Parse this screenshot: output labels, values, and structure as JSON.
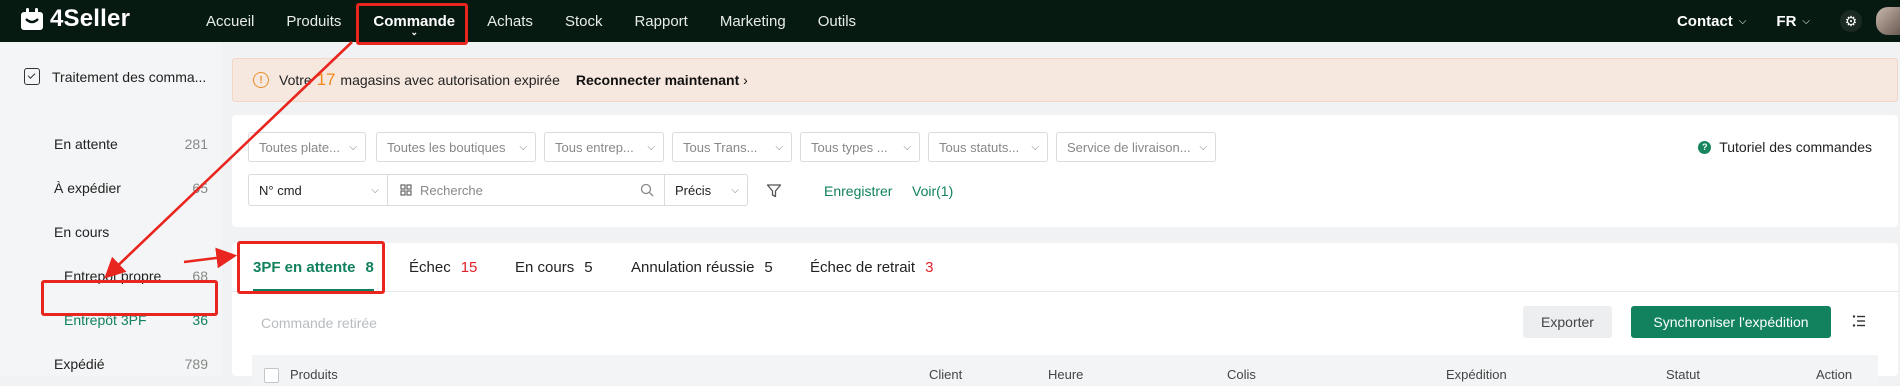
{
  "app": {
    "name": "4Seller"
  },
  "nav": {
    "items": [
      "Accueil",
      "Produits",
      "Commande",
      "Achats",
      "Stock",
      "Rapport",
      "Marketing",
      "Outils"
    ],
    "active": "Commande",
    "contact": "Contact",
    "language": "FR"
  },
  "sidebar": {
    "header": "Traitement des comma...",
    "items": [
      {
        "label": "En attente",
        "count": "281"
      },
      {
        "label": "À expédier",
        "count": "65"
      },
      {
        "label": "En cours",
        "count": ""
      },
      {
        "label": "Entrepôt propre",
        "count": "68"
      },
      {
        "label": "Entrepôt 3PF",
        "count": "36"
      },
      {
        "label": "Expédié",
        "count": "789"
      }
    ]
  },
  "alert": {
    "prefix": "Votre",
    "count": "17",
    "suffix": "magasins avec autorisation expirée",
    "action": "Reconnecter maintenant"
  },
  "filters": {
    "platform": "Toutes plate...",
    "shops": "Toutes les boutiques",
    "warehouse": "Tous entrep...",
    "transport": "Tous Trans...",
    "types": "Tous types ...",
    "status": "Tous statuts...",
    "delivery": "Service de livraison...",
    "search_field": "N° cmd",
    "search_placeholder": "Recherche",
    "match": "Précis",
    "save": "Enregistrer",
    "view": "Voir(1)",
    "tutorial": "Tutoriel des commandes"
  },
  "tabs": [
    {
      "label": "3PF en attente",
      "count": "8"
    },
    {
      "label": "Échec",
      "count": "15"
    },
    {
      "label": "En cours",
      "count": "5"
    },
    {
      "label": "Annulation réussie",
      "count": "5"
    },
    {
      "label": "Échec de retrait",
      "count": "3"
    }
  ],
  "toolbar": {
    "withdrawn": "Commande retirée",
    "export": "Exporter",
    "sync": "Synchroniser l'expédition"
  },
  "table": {
    "columns": [
      "Produits",
      "Client",
      "Heure",
      "Colis",
      "Expédition",
      "Statut",
      "Action"
    ]
  },
  "colors": {
    "brand": "#12815e",
    "annotation": "#e8261f",
    "topbar": "#071a12"
  }
}
